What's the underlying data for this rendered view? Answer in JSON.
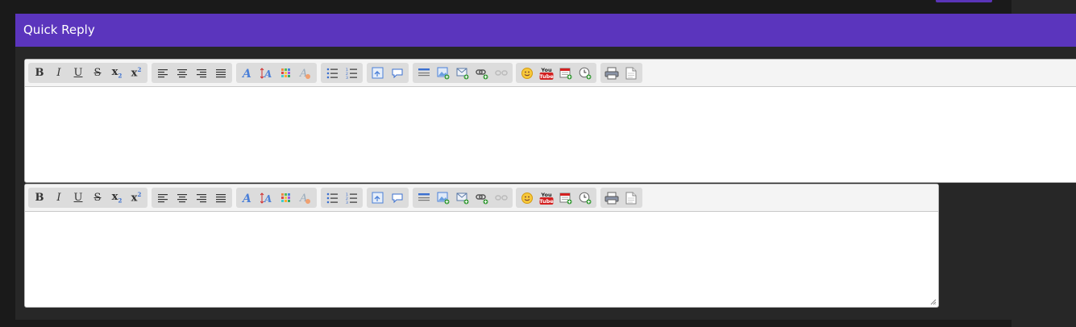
{
  "panel": {
    "title": "Quick Reply"
  },
  "colors": {
    "header_bg": "#5b35bd",
    "page_bg": "#1a1a1a",
    "panel_bg": "#272727",
    "toolbar_bg": "#f4f4f4",
    "group_bg": "#dcdcdc"
  },
  "toolbar": {
    "groups": [
      [
        "bold-icon",
        "italic-icon",
        "underline-icon",
        "strikethrough-icon",
        "subscript-icon",
        "superscript-icon"
      ],
      [
        "align-left-icon",
        "align-center-icon",
        "align-right-icon",
        "justify-icon"
      ],
      [
        "font-face-icon",
        "font-size-icon",
        "text-color-icon",
        "remove-format-icon"
      ],
      [
        "bullet-list-icon",
        "numbered-list-icon"
      ],
      [
        "code-icon",
        "quote-icon"
      ],
      [
        "horizontal-rule-icon",
        "image-icon",
        "email-icon",
        "link-icon",
        "unlink-icon"
      ],
      [
        "emoticon-icon",
        "youtube-icon",
        "date-icon",
        "time-icon"
      ],
      [
        "print-icon",
        "source-icon"
      ]
    ],
    "labels": {
      "bold": "B",
      "italic": "I",
      "underline": "U",
      "strike": "S",
      "sub": "x",
      "sup": "x",
      "youtube_top": "You",
      "youtube_bottom": "Tube"
    }
  },
  "editors": [
    {
      "content": ""
    },
    {
      "content": ""
    }
  ]
}
